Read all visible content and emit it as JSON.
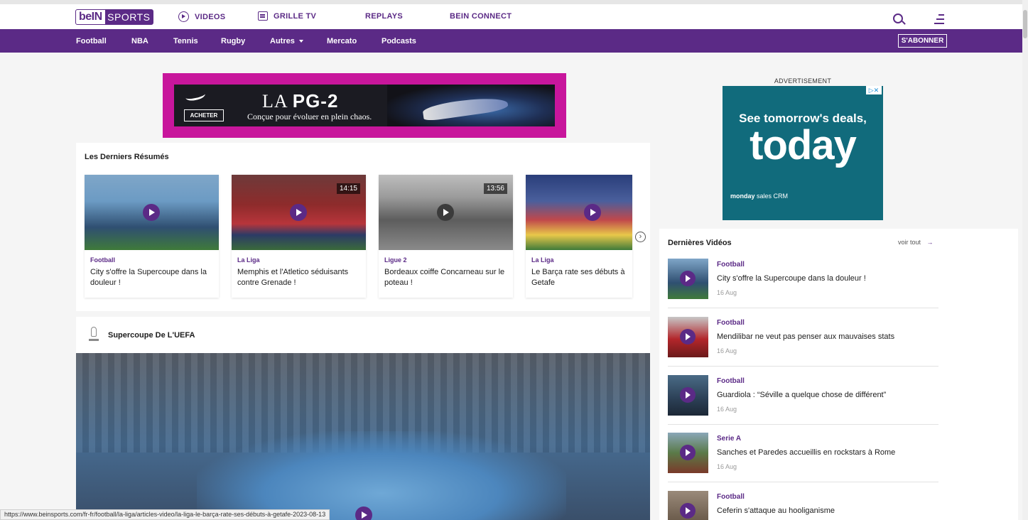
{
  "brand": {
    "part1": "beIN",
    "part2": "SPORTS"
  },
  "topnav": {
    "videos": "VIDEOS",
    "grille": "GRILLE TV",
    "replays": "REPLAYS",
    "connect": "BEIN CONNECT"
  },
  "subnav": {
    "items": [
      "Football",
      "NBA",
      "Tennis",
      "Rugby",
      "Autres",
      "Mercato",
      "Podcasts"
    ],
    "subscribe": "S'ABONNER"
  },
  "ad_banner": {
    "title_a": "LA ",
    "title_b": "PG-2",
    "subtitle": "Conçue pour évoluer en plein chaos.",
    "cta": "ACHETER"
  },
  "resumes": {
    "title": "Les Derniers Résumés",
    "items": [
      {
        "category": "Football",
        "title": "City s'offre la Supercoupe dans la douleur !",
        "duration": ""
      },
      {
        "category": "La Liga",
        "title": "Memphis et l'Atletico séduisants contre Grenade !",
        "duration": "14:15"
      },
      {
        "category": "Ligue 2",
        "title": "Bordeaux coiffe Concarneau sur le poteau !",
        "duration": "13:56"
      },
      {
        "category": "La Liga",
        "title": "Le Barça rate ses débuts à Getafe",
        "duration": ""
      }
    ]
  },
  "supercoupe": {
    "title": "Supercoupe De L'UEFA"
  },
  "ad_side": {
    "label": "ADVERTISEMENT",
    "line1": "See tomorrow's deals,",
    "line2": "today",
    "brand": "monday",
    "brand_suffix": " sales CRM"
  },
  "videos": {
    "title": "Dernières Vidéos",
    "see_all": "voir tout",
    "items": [
      {
        "category": "Football",
        "title": "City s'offre la Supercoupe dans la douleur !",
        "date": "16 Aug"
      },
      {
        "category": "Football",
        "title": "Mendilibar ne veut pas penser aux mauvaises stats",
        "date": "16 Aug"
      },
      {
        "category": "Football",
        "title": "Guardiola : “Séville a quelque chose de différent”",
        "date": "16 Aug"
      },
      {
        "category": "Serie A",
        "title": "Sanches et Paredes accueillis en rockstars à Rome",
        "date": "16 Aug"
      },
      {
        "category": "Football",
        "title": "Ceferin s'attaque au hooliganisme",
        "date": ""
      }
    ]
  },
  "status_url": "https://www.beinsports.com/fr-fr/football/la-liga/articles-video/la-liga-le-barça-rate-ses-débuts-à-getafe-2023-08-13"
}
